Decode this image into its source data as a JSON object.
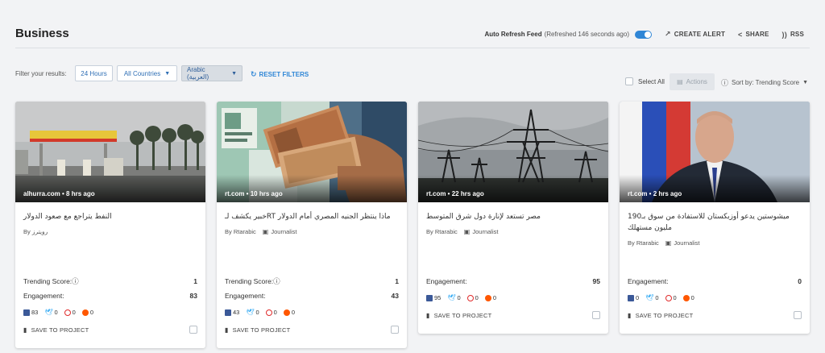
{
  "page": {
    "title": "Business"
  },
  "header": {
    "auto_refresh_label": "Auto Refresh Feed",
    "auto_refresh_status": "(Refreshed 146 seconds ago)",
    "create_alert": "CREATE ALERT",
    "share": "SHARE",
    "rss": "RSS"
  },
  "filters": {
    "label": "Filter your results:",
    "time": "24 Hours",
    "countries": "All Countries",
    "language": "Arabic (العربية)",
    "reset": "RESET FILTERS",
    "select_all": "Select All",
    "actions": "Actions",
    "sort": "Sort by: Trending Score"
  },
  "labels": {
    "trending": "Trending Score:",
    "engagement": "Engagement:",
    "save": "SAVE TO PROJECT",
    "by": "By"
  },
  "articles": [
    {
      "source": "alhurra.com • 8 hrs ago",
      "title": "النفط يتراجع مع صعود الدولار",
      "author": "رويترز",
      "journalist": "",
      "trending": "1",
      "engagement": "83",
      "facebook": "83",
      "twitter": "0",
      "pinterest": "0",
      "reddit": "0"
    },
    {
      "source": "rt.com • 10 hrs ago",
      "title": "ماذا ينتظر الجنيه المصري أمام الدولار RTخبير يكشف لـ",
      "author": "Rtarabic",
      "journalist": "Journalist",
      "trending": "1",
      "engagement": "43",
      "facebook": "43",
      "twitter": "0",
      "pinterest": "0",
      "reddit": "0"
    },
    {
      "source": "rt.com • 22 hrs ago",
      "title": "مصر تستعد لإنارة دول شرق المتوسط",
      "author": "Rtarabic",
      "journalist": "Journalist",
      "trending": "",
      "engagement": "95",
      "facebook": "95",
      "twitter": "0",
      "pinterest": "0",
      "reddit": "0"
    },
    {
      "source": "rt.com • 2 hrs ago",
      "title": "ميشوستين يدعو أوزبكستان للاستفادة من سوق بـ190 مليون مستهلك",
      "author": "Rtarabic",
      "journalist": "Journalist",
      "trending": "",
      "engagement": "0",
      "facebook": "0",
      "twitter": "0",
      "pinterest": "0",
      "reddit": "0"
    }
  ],
  "icons": {
    "refresh": "refresh-icon",
    "alert": "trend-arrow-icon",
    "share": "share-icon",
    "rss": "rss-icon",
    "info": "info-icon",
    "bookmark": "bookmark-icon",
    "journalist": "newspaper-icon"
  },
  "colors": {
    "accent": "#2f86d6",
    "facebook": "#3b5998",
    "twitter": "#1da1f2",
    "pinterest": "#e02b2b",
    "reddit": "#ff5700"
  }
}
